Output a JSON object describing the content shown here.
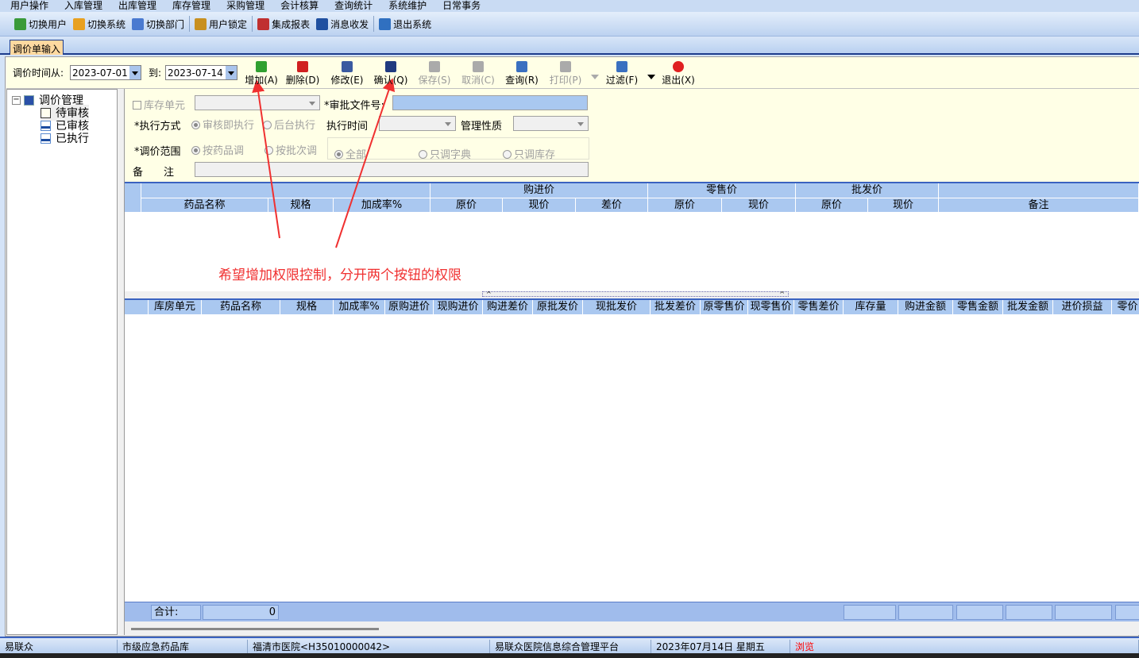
{
  "menu": [
    "用户操作",
    "入库管理",
    "出库管理",
    "库存管理",
    "采购管理",
    "会计核算",
    "查询统计",
    "系统维护",
    "日常事务"
  ],
  "toolbar": [
    {
      "label": "切换用户",
      "icon": "switch-user-icon",
      "color": "#3a9a3a"
    },
    {
      "label": "切换系统",
      "icon": "switch-system-icon",
      "color": "#e8a020"
    },
    {
      "label": "切换部门",
      "icon": "switch-department-icon",
      "color": "#4a7ad0"
    },
    {
      "label": "用户锁定",
      "icon": "user-lock-icon",
      "color": "#c89020"
    },
    {
      "label": "集成报表",
      "icon": "report-icon",
      "color": "#c03030"
    },
    {
      "label": "消息收发",
      "icon": "info-message-icon",
      "color": "#2050a0"
    },
    {
      "label": "退出系统",
      "icon": "exit-system-icon",
      "color": "#3070c0"
    }
  ],
  "tab": "调价单输入",
  "actionbar": {
    "from_label": "调价时间从:",
    "from_value": "2023-07-01",
    "to_label": "到:",
    "to_value": "2023-07-14",
    "buttons": [
      {
        "label": "增加(A)",
        "icon": "add-icon",
        "color": "#30a030",
        "enabled": true
      },
      {
        "label": "删除(D)",
        "icon": "delete-icon",
        "color": "#d02020",
        "enabled": true
      },
      {
        "label": "修改(E)",
        "icon": "edit-icon",
        "color": "#3a5aa0",
        "enabled": true
      },
      {
        "label": "确认(Q)",
        "icon": "confirm-checkbox-icon",
        "color": "#203a80",
        "enabled": true
      },
      {
        "label": "保存(S)",
        "icon": "save-icon",
        "color": "#aaaaaa",
        "enabled": false
      },
      {
        "label": "取消(C)",
        "icon": "cancel-icon",
        "color": "#aaaaaa",
        "enabled": false
      },
      {
        "label": "查询(R)",
        "icon": "query-icon",
        "color": "#3a70c0",
        "enabled": true
      },
      {
        "label": "打印(P)",
        "icon": "print-icon",
        "color": "#aaaaaa",
        "enabled": false
      },
      {
        "label": "过滤(F)",
        "icon": "filter-icon",
        "color": "#3a70c0",
        "enabled": true
      },
      {
        "label": "退出(X)",
        "icon": "power-exit-icon",
        "color": "#e02020",
        "enabled": true
      }
    ]
  },
  "tree": {
    "root": "调价管理",
    "children": [
      "待审核",
      "已审核",
      "已执行"
    ]
  },
  "form": {
    "stock_unit": "库存单元",
    "approval_no": "*审批文件号:",
    "exec_mode": "*执行方式",
    "exec_opt1": "审核即执行",
    "exec_opt2": "后台执行",
    "exec_time": "执行时间",
    "mgmt_type": "管理性质",
    "scope": "*调价范围",
    "scope_opt1": "按药品调",
    "scope_opt2": "按批次调",
    "range_all": "全部",
    "range_dict": "只调字典",
    "range_stock": "只调库存",
    "remark": "备　　注"
  },
  "grid1": {
    "groups": [
      "购进价",
      "零售价",
      "批发价"
    ],
    "columns": [
      "药品名称",
      "规格",
      "加成率%",
      "原价",
      "现价",
      "差价",
      "原价",
      "现价",
      "原价",
      "现价",
      "备注"
    ]
  },
  "grid2": {
    "columns": [
      "库房单元",
      "药品名称",
      "规格",
      "加成率%",
      "原购进价",
      "现购进价",
      "购进差价",
      "原批发价",
      "现批发价",
      "批发差价",
      "原零售价",
      "现零售价",
      "零售差价",
      "库存量",
      "购进金额",
      "零售金额",
      "批发金额",
      "进价损益",
      "零价"
    ]
  },
  "footer": {
    "total_label": "合计:",
    "total_value": "0"
  },
  "status": [
    "易联众",
    "市级应急药品库",
    "福清市医院<H35010000042>",
    "易联众医院信息综合管理平台",
    "2023年07月14日 星期五",
    "浏览"
  ],
  "annotation": {
    "text": "希望增加权限控制，分开两个按钮的权限",
    "color": "#f03030"
  }
}
